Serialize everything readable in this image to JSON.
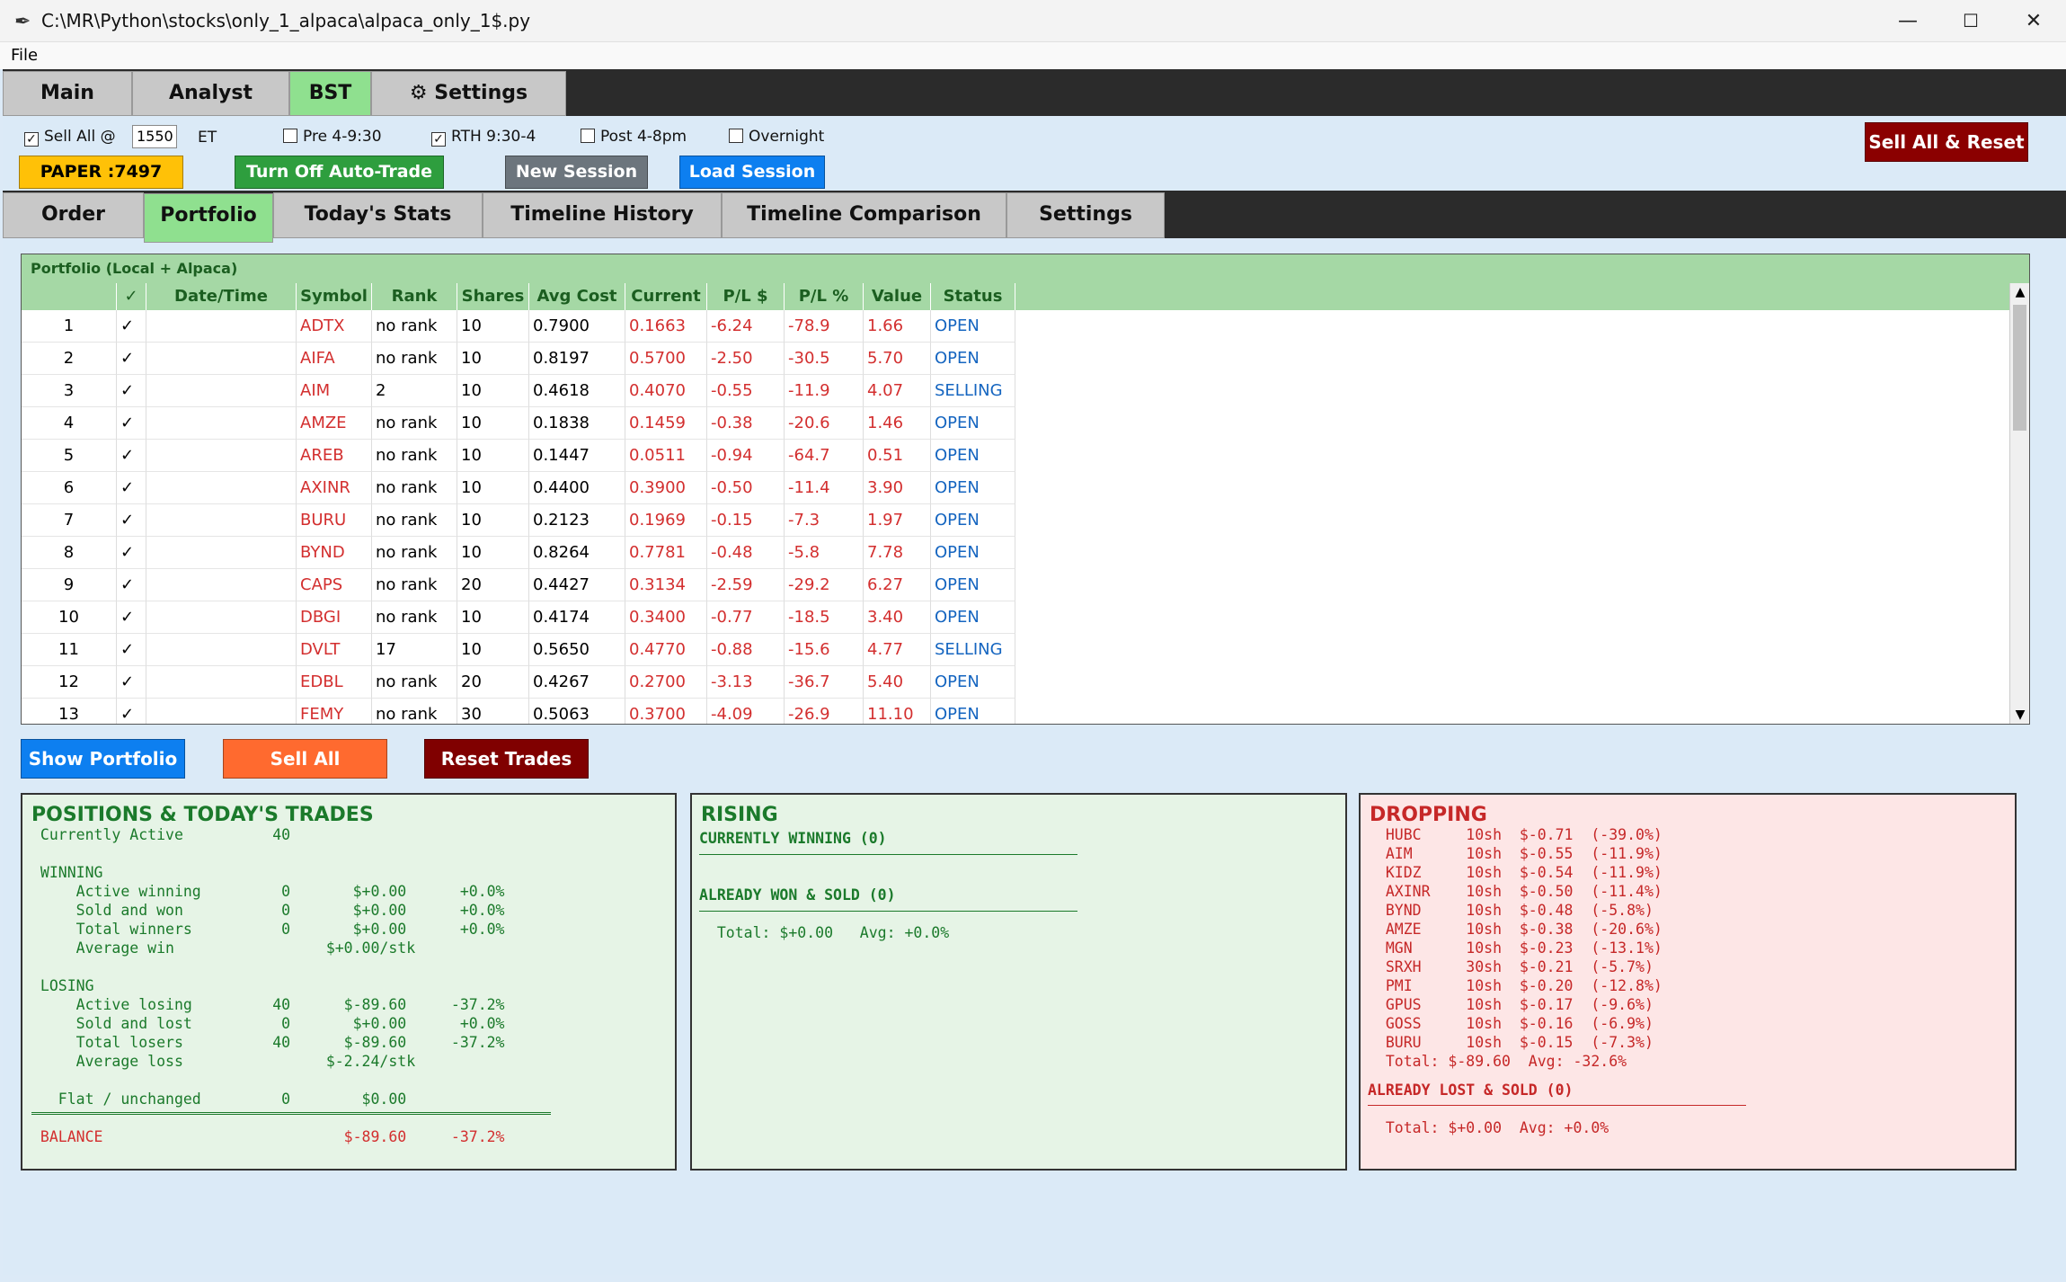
{
  "window": {
    "title": "C:\\MR\\Python\\stocks\\only_1_alpaca\\alpaca_only_1$.py",
    "minimize": "—",
    "maximize": "☐",
    "close": "✕"
  },
  "menu": {
    "file": "File"
  },
  "main_tabs": [
    "Main",
    "Analyst",
    "BST",
    "⚙ Settings"
  ],
  "controls": {
    "sell_all_label": "Sell All @",
    "sell_all_time": "1550",
    "et": "ET",
    "pre": "Pre 4-9:30",
    "rth": "RTH 9:30-4",
    "post": "Post 4-8pm",
    "overnight": "Overnight",
    "sell_all_reset": "Sell All & Reset",
    "paper": "PAPER :7497",
    "auto_trade": "Turn Off Auto-Trade",
    "new_session": "New Session",
    "load_session": "Load Session"
  },
  "sub_tabs": [
    "Order",
    "Portfolio",
    "Today's Stats",
    "Timeline History",
    "Timeline Comparison",
    "Settings"
  ],
  "portfolio": {
    "header": "Portfolio (Local + Alpaca)",
    "columns": [
      "",
      "✓",
      "Date/Time",
      "Symbol",
      "Rank",
      "Shares",
      "Avg Cost",
      "Current",
      "P/L $",
      "P/L %",
      "Value",
      "Status"
    ],
    "rows": [
      [
        "1",
        "✓",
        "",
        "ADTX",
        "no rank",
        "10",
        "0.7900",
        "0.1663",
        "-6.24",
        "-78.9",
        "1.66",
        "OPEN"
      ],
      [
        "2",
        "✓",
        "",
        "AIFA",
        "no rank",
        "10",
        "0.8197",
        "0.5700",
        "-2.50",
        "-30.5",
        "5.70",
        "OPEN"
      ],
      [
        "3",
        "✓",
        "",
        "AIM",
        "2",
        "10",
        "0.4618",
        "0.4070",
        "-0.55",
        "-11.9",
        "4.07",
        "SELLING"
      ],
      [
        "4",
        "✓",
        "",
        "AMZE",
        "no rank",
        "10",
        "0.1838",
        "0.1459",
        "-0.38",
        "-20.6",
        "1.46",
        "OPEN"
      ],
      [
        "5",
        "✓",
        "",
        "AREB",
        "no rank",
        "10",
        "0.1447",
        "0.0511",
        "-0.94",
        "-64.7",
        "0.51",
        "OPEN"
      ],
      [
        "6",
        "✓",
        "",
        "AXINR",
        "no rank",
        "10",
        "0.4400",
        "0.3900",
        "-0.50",
        "-11.4",
        "3.90",
        "OPEN"
      ],
      [
        "7",
        "✓",
        "",
        "BURU",
        "no rank",
        "10",
        "0.2123",
        "0.1969",
        "-0.15",
        "-7.3",
        "1.97",
        "OPEN"
      ],
      [
        "8",
        "✓",
        "",
        "BYND",
        "no rank",
        "10",
        "0.8264",
        "0.7781",
        "-0.48",
        "-5.8",
        "7.78",
        "OPEN"
      ],
      [
        "9",
        "✓",
        "",
        "CAPS",
        "no rank",
        "20",
        "0.4427",
        "0.3134",
        "-2.59",
        "-29.2",
        "6.27",
        "OPEN"
      ],
      [
        "10",
        "✓",
        "",
        "DBGI",
        "no rank",
        "10",
        "0.4174",
        "0.3400",
        "-0.77",
        "-18.5",
        "3.40",
        "OPEN"
      ],
      [
        "11",
        "✓",
        "",
        "DVLT",
        "17",
        "10",
        "0.5650",
        "0.4770",
        "-0.88",
        "-15.6",
        "4.77",
        "SELLING"
      ],
      [
        "12",
        "✓",
        "",
        "EDBL",
        "no rank",
        "20",
        "0.4267",
        "0.2700",
        "-3.13",
        "-36.7",
        "5.40",
        "OPEN"
      ],
      [
        "13",
        "✓",
        "",
        "FEMY",
        "no rank",
        "30",
        "0.5063",
        "0.3700",
        "-4.09",
        "-26.9",
        "11.10",
        "OPEN"
      ]
    ]
  },
  "actions": {
    "show_portfolio": "Show Portfolio",
    "sell_all": "Sell All",
    "reset_trades": "Reset Trades"
  },
  "positions_panel": {
    "title": "POSITIONS & TODAY'S TRADES",
    "lines": [
      " Currently Active          40",
      "",
      " WINNING",
      "     Active winning         0       $+0.00      +0.0%",
      "     Sold and won           0       $+0.00      +0.0%",
      "     Total winners          0       $+0.00      +0.0%",
      "     Average win                 $+0.00/stk",
      "",
      " LOSING",
      "     Active losing         40      $-89.60     -37.2%",
      "     Sold and lost          0       $+0.00      +0.0%",
      "     Total losers          40      $-89.60     -37.2%",
      "     Average loss                $-2.24/stk",
      "",
      "   Flat / unchanged         0        $0.00"
    ],
    "balance": " BALANCE                           $-89.60     -37.2%"
  },
  "rising_panel": {
    "title": "RISING",
    "currently_winning": "CURRENTLY WINNING (0)",
    "already_won": "ALREADY WON & SOLD (0)",
    "total": "  Total: $+0.00   Avg: +0.0%"
  },
  "dropping_panel": {
    "title": "DROPPING",
    "lines": [
      "  HUBC     10sh  $-0.71  (-39.0%)",
      "  AIM      10sh  $-0.55  (-11.9%)",
      "  KIDZ     10sh  $-0.54  (-11.9%)",
      "  AXINR    10sh  $-0.50  (-11.4%)",
      "  BYND     10sh  $-0.48  (-5.8%)",
      "  AMZE     10sh  $-0.38  (-20.6%)",
      "  MGN      10sh  $-0.23  (-13.1%)",
      "  SRXH     30sh  $-0.21  (-5.7%)",
      "  PMI      10sh  $-0.20  (-12.8%)",
      "  GPUS     10sh  $-0.17  (-9.6%)",
      "  GOSS     10sh  $-0.16  (-6.9%)",
      "  BURU     10sh  $-0.15  (-7.3%)",
      "  Total: $-89.60  Avg: -32.6%"
    ],
    "already_lost": "ALREADY LOST & SOLD (0)",
    "total": "  Total: $+0.00  Avg: +0.0%"
  },
  "colors": {
    "active_tab": "#8fe08f",
    "paper": "#ffc107",
    "auto_trade": "#2e9e3e",
    "new_session": "#6c757d",
    "load_session": "#0d7ff0",
    "sell_reset": "#8b0000",
    "sell_all": "#ff6a2f",
    "reset_trades": "#800000",
    "show_portfolio": "#0d7ff0"
  }
}
